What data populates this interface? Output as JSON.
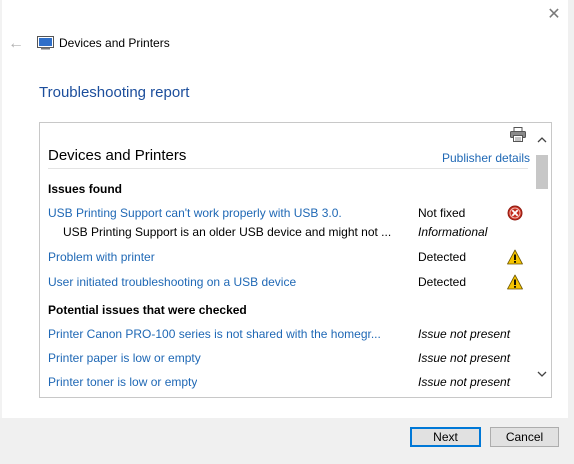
{
  "window": {
    "close_glyph": "✕",
    "back_glyph": "←",
    "app_title": "Devices and Printers",
    "report_title": "Troubleshooting report"
  },
  "panel": {
    "heading": "Devices and Printers",
    "publisher_link": "Publisher details",
    "issues_found_title": "Issues found",
    "issues_found": [
      {
        "name": "USB Printing Support can't work properly with USB 3.0.",
        "status": "Not fixed",
        "italic": false,
        "icon": "error-icon"
      },
      {
        "name": "USB Printing Support is an older USB device and might not ...",
        "status": "Informational",
        "italic": true,
        "icon": ""
      },
      {
        "name": "Problem with printer",
        "status": "Detected",
        "italic": false,
        "icon": "warning-icon"
      },
      {
        "name": "User initiated troubleshooting on a USB device",
        "status": "Detected",
        "italic": false,
        "icon": "warning-icon"
      }
    ],
    "potential_title": "Potential issues that were checked",
    "potential": [
      {
        "name": "Printer Canon PRO-100 series is not shared with the homegr...",
        "status": "Issue not present"
      },
      {
        "name": "Printer paper is low or empty",
        "status": "Issue not present"
      },
      {
        "name": "Printer toner is low or empty",
        "status": "Issue not present"
      }
    ]
  },
  "footer": {
    "next_label": "Next",
    "cancel_label": "Cancel"
  },
  "colors": {
    "link": "#1f68b5",
    "title": "#1c4e9c",
    "error": "#c42b1c",
    "warning": "#f5c400"
  }
}
